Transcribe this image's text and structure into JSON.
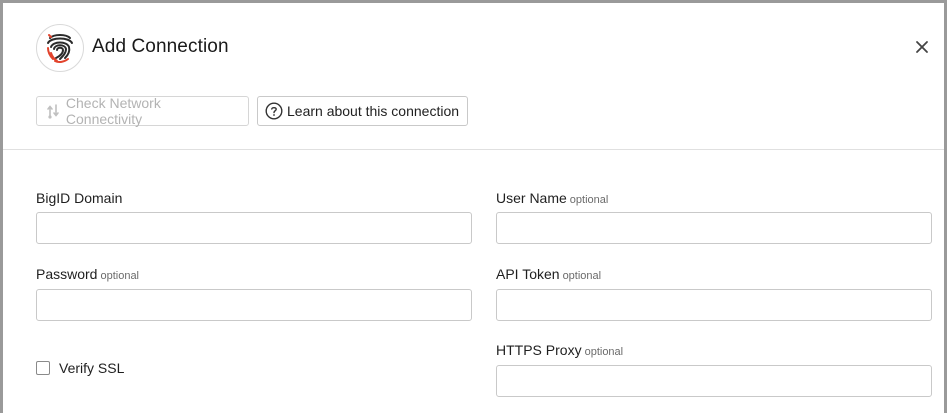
{
  "dialog": {
    "title": "Add Connection",
    "close_icon": "close-icon",
    "logo_icon": "fingerprint-logo-icon"
  },
  "toolbar": {
    "check_network_label": "Check Network Connectivity",
    "check_network_icon": "network-connectivity-icon",
    "check_network_disabled": true,
    "learn_label": "Learn about this connection",
    "learn_icon": "help-circle-icon"
  },
  "form": {
    "optional_text": "optional",
    "fields": {
      "bigid_domain": {
        "label": "BigID Domain",
        "value": ""
      },
      "user_name": {
        "label": "User Name",
        "optional": "optional",
        "value": ""
      },
      "password": {
        "label": "Password",
        "optional": "optional",
        "value": ""
      },
      "api_token": {
        "label": "API Token",
        "optional": "optional",
        "value": ""
      },
      "https_proxy": {
        "label": "HTTPS Proxy",
        "optional": "optional",
        "value": ""
      }
    },
    "verify_ssl": {
      "label": "Verify SSL",
      "checked": false
    }
  },
  "colors": {
    "logo_accent": "#e2432c",
    "logo_dark": "#2b2b2b",
    "border": "#c9c9c9",
    "disabled_text": "#b3b3b3"
  }
}
